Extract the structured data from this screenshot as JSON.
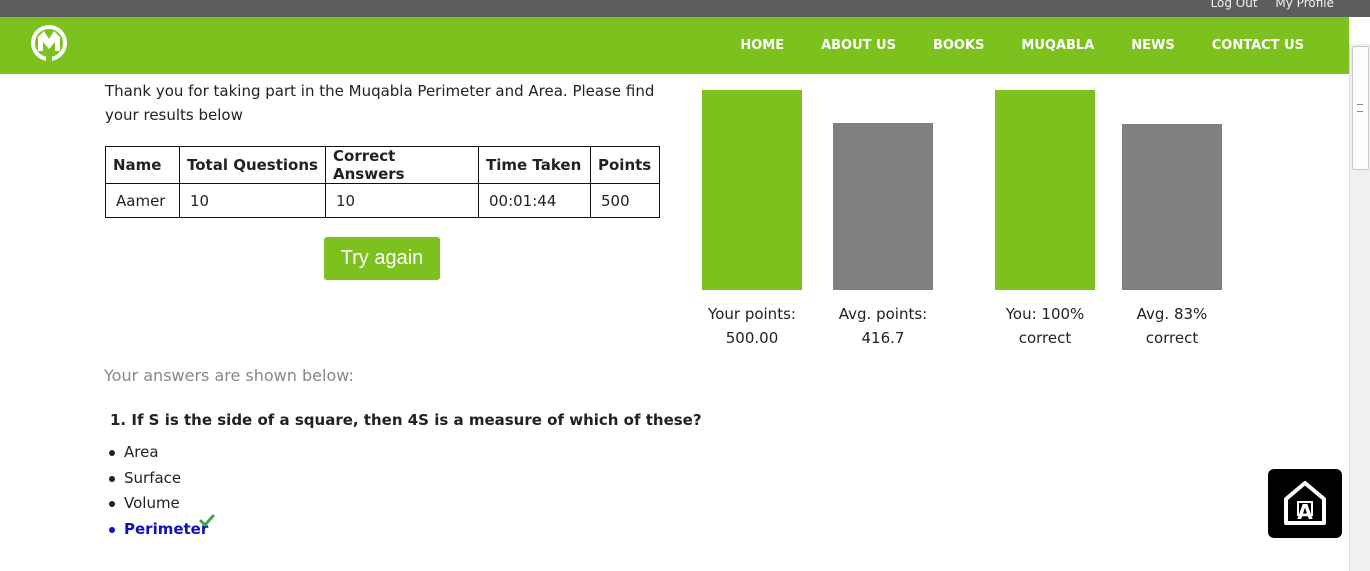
{
  "top_links": [
    "Log Out",
    "My Profile"
  ],
  "nav": [
    "HOME",
    "ABOUT US",
    "BOOKS",
    "MUQABLA",
    "NEWS",
    "CONTACT US"
  ],
  "logo": {
    "name": "muqabla-logo",
    "tagline": "Muqabla"
  },
  "intro": "Thank you for taking part in the Muqabla Perimeter and Area. Please find your results below",
  "table": {
    "headers": [
      "Name",
      "Total Questions",
      "Correct Answers",
      "Time Taken",
      "Points"
    ],
    "row": [
      "Aamer",
      "10",
      "10",
      "00:01:44",
      "500"
    ]
  },
  "try_again": "Try again",
  "chart_data": [
    {
      "type": "bar",
      "categories": [
        "Your points: 500.00",
        "Avg. points: 416.7"
      ],
      "values": [
        500,
        416.7
      ],
      "ylim": [
        0,
        500
      ],
      "colors": [
        "#7dc11f",
        "#808080"
      ],
      "labels": [
        [
          "Your points:",
          "500.00"
        ],
        [
          "Avg. points:",
          "416.7"
        ]
      ]
    },
    {
      "type": "bar",
      "categories": [
        "You: 100% correct",
        "Avg. 83% correct"
      ],
      "values": [
        100,
        83
      ],
      "ylim": [
        0,
        100
      ],
      "colors": [
        "#7dc11f",
        "#808080"
      ],
      "labels": [
        [
          "You: 100%",
          "correct"
        ],
        [
          "Avg. 83%",
          "correct"
        ]
      ]
    }
  ],
  "answers_heading": "Your answers are shown below:",
  "question": {
    "text": "1. If S is the side of a square, then 4S is a measure of which of these?",
    "options": [
      {
        "label": "Area",
        "correct": false
      },
      {
        "label": "Surface",
        "correct": false
      },
      {
        "label": "Volume",
        "correct": false
      },
      {
        "label": "Perimeter",
        "correct": true
      }
    ]
  },
  "colors": {
    "brand_green": "#7dc11f",
    "bar_gray": "#808080",
    "correct_blue": "#1212b8",
    "check_green": "#3aa845"
  },
  "icons": {
    "accessibility": "accessibility-icon",
    "check": "check-icon"
  }
}
